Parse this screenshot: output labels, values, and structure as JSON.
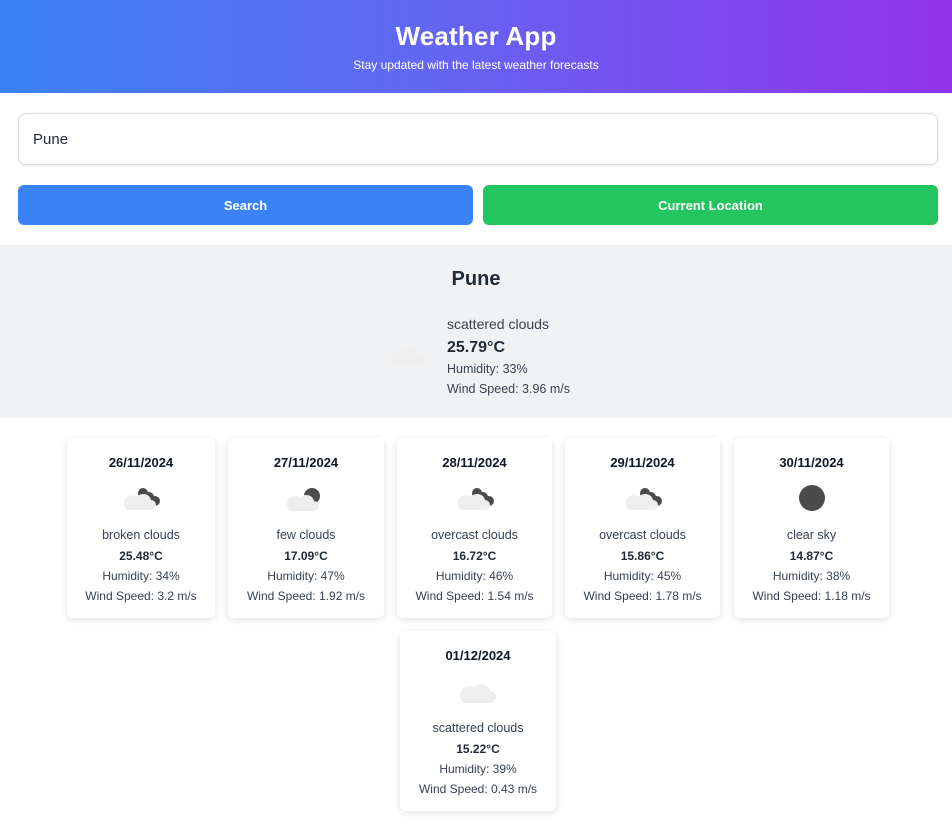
{
  "header": {
    "title": "Weather App",
    "subtitle": "Stay updated with the latest weather forecasts"
  },
  "search": {
    "value": "Pune",
    "search_label": "Search",
    "location_label": "Current Location"
  },
  "current": {
    "city": "Pune",
    "icon": "scattered-clouds-icon",
    "description": "scattered clouds",
    "temperature": "25.79°C",
    "humidity": "Humidity: 33%",
    "wind": "Wind Speed: 3.96 m/s"
  },
  "forecast": [
    {
      "date": "26/11/2024",
      "icon": "broken-clouds-icon",
      "description": "broken clouds",
      "temperature": "25.48°C",
      "humidity": "Humidity: 34%",
      "wind": "Wind Speed: 3.2 m/s"
    },
    {
      "date": "27/11/2024",
      "icon": "few-clouds-icon",
      "description": "few clouds",
      "temperature": "17.09°C",
      "humidity": "Humidity: 47%",
      "wind": "Wind Speed: 1.92 m/s"
    },
    {
      "date": "28/11/2024",
      "icon": "overcast-clouds-icon",
      "description": "overcast clouds",
      "temperature": "16.72°C",
      "humidity": "Humidity: 46%",
      "wind": "Wind Speed: 1.54 m/s"
    },
    {
      "date": "29/11/2024",
      "icon": "overcast-clouds-icon",
      "description": "overcast clouds",
      "temperature": "15.86°C",
      "humidity": "Humidity: 45%",
      "wind": "Wind Speed: 1.78 m/s"
    },
    {
      "date": "30/11/2024",
      "icon": "clear-sky-icon",
      "description": "clear sky",
      "temperature": "14.87°C",
      "humidity": "Humidity: 38%",
      "wind": "Wind Speed: 1.18 m/s"
    },
    {
      "date": "01/12/2024",
      "icon": "scattered-clouds-icon",
      "description": "scattered clouds",
      "temperature": "15.22°C",
      "humidity": "Humidity: 39%",
      "wind": "Wind Speed: 0.43 m/s"
    }
  ],
  "colors": {
    "header_gradient_start": "#3b82f6",
    "header_gradient_end": "#9333ea",
    "search_button": "#3b82f6",
    "location_button": "#22c55e",
    "current_panel_bg": "#f1f2f4"
  }
}
